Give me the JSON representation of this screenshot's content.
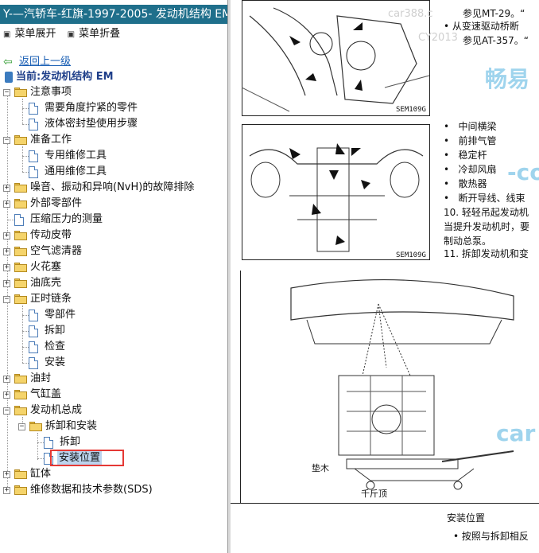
{
  "window": {
    "title": "Y-—汽轿车-红旗-1997-2005- 发动机结构 EM."
  },
  "menu": {
    "expand_all": "菜单展开",
    "collapse_all": "菜单折叠"
  },
  "nav": {
    "back": "返回上一级",
    "current": "当前:发动机结构 EM"
  },
  "tree": {
    "n01": "注意事项",
    "n02": "需要角度拧紧的零件",
    "n03": "液体密封垫使用步骤",
    "n04": "准备工作",
    "n05": "专用维修工具",
    "n06": "通用维修工具",
    "n07": "噪音、振动和异响(NvH)的故障排除",
    "n08": "外部零部件",
    "n09": "压缩压力的测量",
    "n10": "传动皮带",
    "n11": "空气滤清器",
    "n12": "火花塞",
    "n13": "油底壳",
    "n14": "正时链条",
    "n15": "零部件",
    "n16": "拆卸",
    "n17": "检查",
    "n18": "安装",
    "n19": "油封",
    "n20": "气缸盖",
    "n21": "发动机总成",
    "n22": "拆卸和安装",
    "n23": "拆卸",
    "n24": "安装位置",
    "n25": "缸体",
    "n26": "维修数据和技术参数(SDS)"
  },
  "document": {
    "top_line1": "参见MT-29。“",
    "top_line2": "• 从变速驱动桥断",
    "top_line3": "参见AT-357。“",
    "fig1_code": "SEM109G",
    "fig2_code": "SEM109G",
    "list": [
      "中间横梁",
      "前排气管",
      "稳定杆",
      "冷却风扇",
      "散热器",
      "断开导线、线束"
    ],
    "step10_a": "10. 轻轻吊起发动机",
    "step10_b": "当提升发动机时，要",
    "step10_c": "制动总泵。",
    "step11": "11. 拆卸发动机和变",
    "label_block": "垫木",
    "label_jack": "千斤顶",
    "section_title": "安装位置",
    "section_bullet": "• 按照与拆卸相反"
  },
  "watermarks": {
    "w1": "畅易",
    "w2": "-co",
    "w3": "car",
    "w4": "car388.c",
    "w5": "CY2013"
  }
}
